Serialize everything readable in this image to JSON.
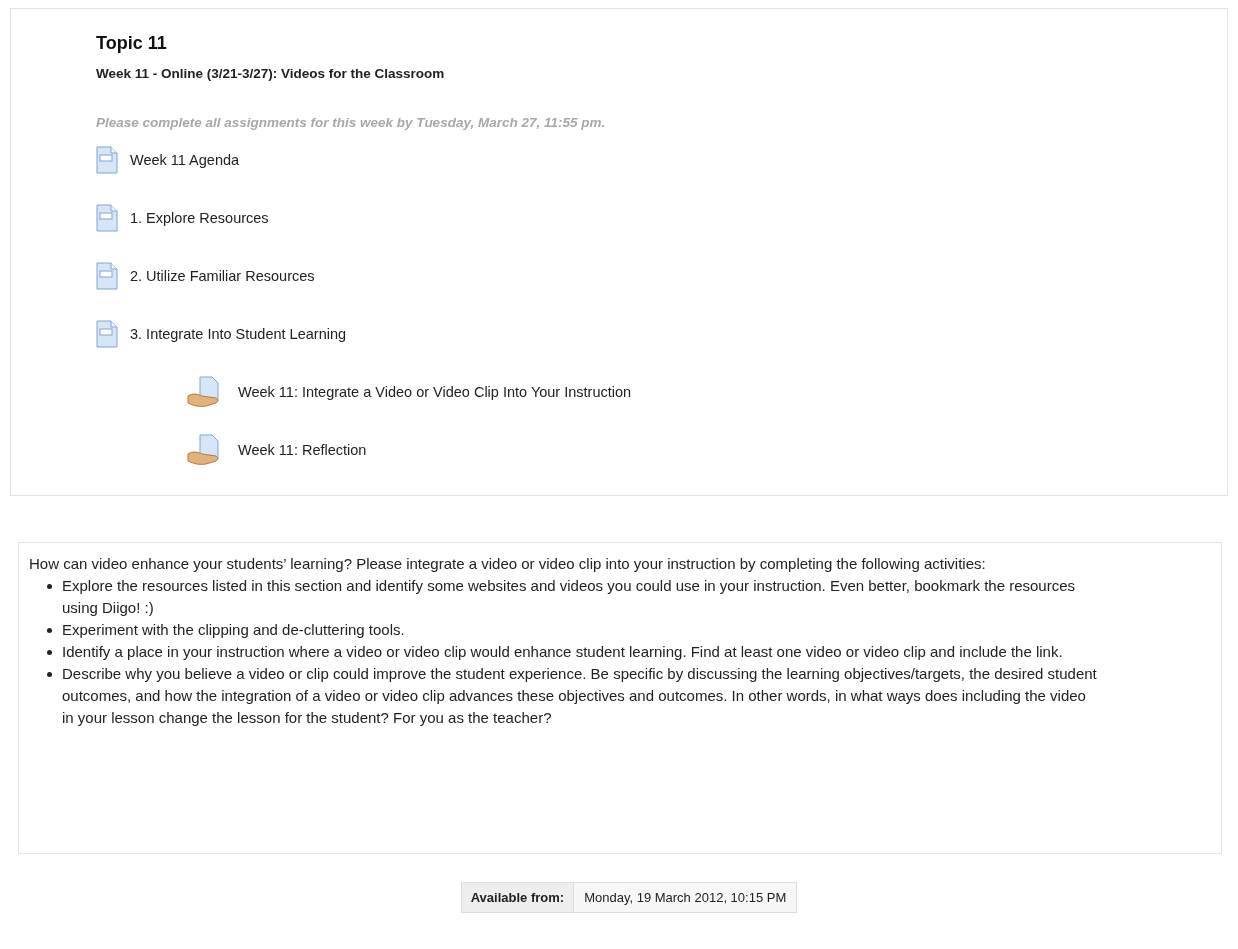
{
  "section": {
    "title": "Topic 11",
    "subtitle": "Week 11 - Online (3/21-3/27): Videos for the Classroom",
    "note": "Please complete all assignments for this week by Tuesday, March 27, 11:55 pm.",
    "items": [
      {
        "label": "Week 11 Agenda",
        "kind": "resource"
      },
      {
        "label": "1. Explore Resources",
        "kind": "resource"
      },
      {
        "label": "2. Utilize Familiar Resources",
        "kind": "resource"
      },
      {
        "label": "3. Integrate Into Student Learning",
        "kind": "resource",
        "children": [
          {
            "label": "Week 11: Integrate a Video or Video Clip Into Your Instruction",
            "kind": "assignment"
          },
          {
            "label": "Week 11: Reflection",
            "kind": "assignment"
          }
        ]
      }
    ]
  },
  "description": {
    "intro": "How can video enhance your students’ learning? Please integrate a video or video clip into your instruction by completing the following activities:",
    "bullets": [
      "Explore the resources listed in this section and identify some websites and videos you could use in your instruction. Even better, bookmark the resources using Diigo! :)",
      "Experiment with the clipping and de-cluttering tools.",
      "Identify a place in your instruction where a video or video clip would enhance student learning. Find at least one video or video clip and include the link.",
      "Describe why you believe a video or clip could improve the student experience. Be specific by discussing the learning objectives/targets, the desired student outcomes, and how the integration of a video or video clip advances these objectives and outcomes. In other words, in what ways does including the video in your lesson change the lesson for the student? For you as the teacher?"
    ]
  },
  "availability": {
    "label": "Available from:",
    "value": "Monday, 19 March 2012, 10:15 PM"
  }
}
